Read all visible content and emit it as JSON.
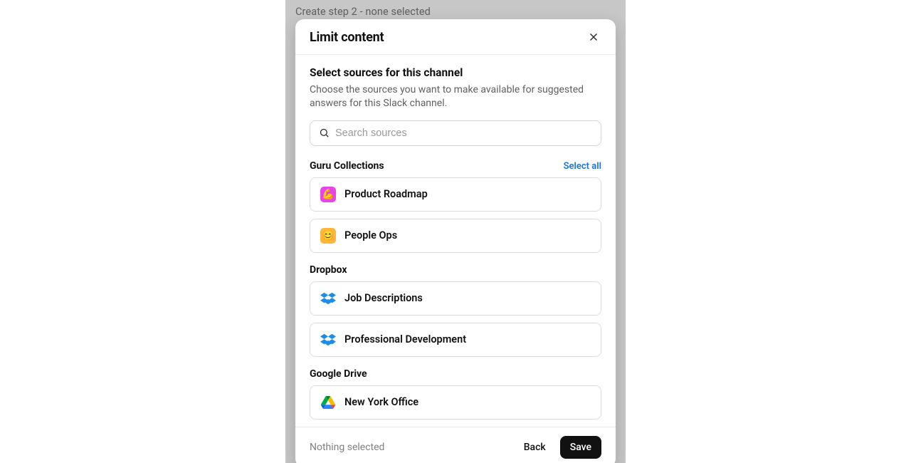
{
  "stage_caption": "Create step 2 - none selected",
  "modal": {
    "title": "Limit content",
    "section_title": "Select sources for this channel",
    "section_desc": "Choose the sources you want to make available for suggested answers for this Slack channel.",
    "search_placeholder": "Search sources",
    "select_all_label": "Select all",
    "groups": [
      {
        "label": "Guru Collections",
        "has_select_all": true,
        "items": [
          {
            "name": "Product Roadmap",
            "icon": "guru-pink",
            "emoji": "💪"
          },
          {
            "name": "People Ops",
            "icon": "guru-orange",
            "emoji": "😊"
          }
        ]
      },
      {
        "label": "Dropbox",
        "has_select_all": false,
        "items": [
          {
            "name": "Job Descriptions",
            "icon": "dropbox"
          },
          {
            "name": "Professional Development",
            "icon": "dropbox"
          }
        ]
      },
      {
        "label": "Google Drive",
        "has_select_all": false,
        "items": [
          {
            "name": "New York Office",
            "icon": "gdrive"
          }
        ]
      }
    ],
    "footer_status": "Nothing selected",
    "back_label": "Back",
    "save_label": "Save"
  }
}
